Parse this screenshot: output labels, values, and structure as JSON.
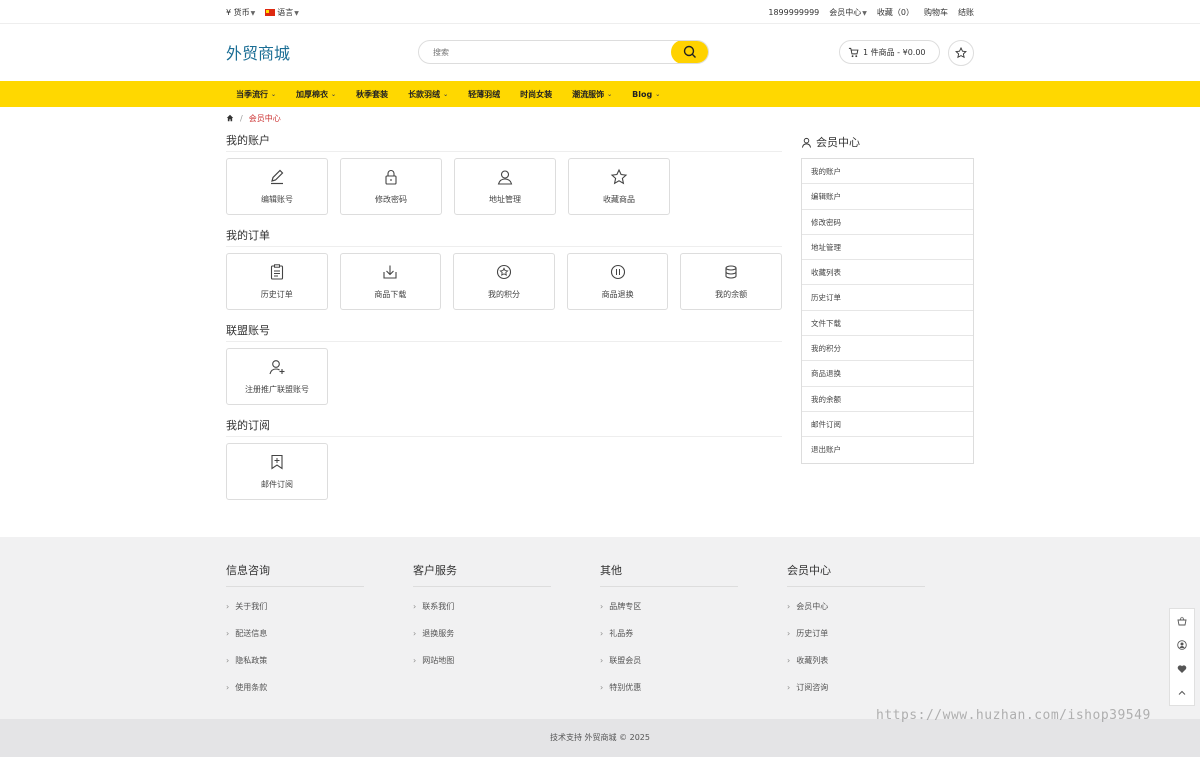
{
  "topbar": {
    "currency_label": "¥ 货币",
    "language_label": "语言",
    "phone": "1899999999",
    "member_center": "会员中心",
    "favorites": "收藏（0）",
    "cart": "购物车",
    "checkout": "结账"
  },
  "header": {
    "logo": "外贸商城",
    "search_placeholder": "搜索",
    "cart_summary": "1 件商品 - ¥0.00"
  },
  "nav": {
    "items": [
      {
        "label": "当季流行",
        "dropdown": true
      },
      {
        "label": "加厚棉衣",
        "dropdown": true
      },
      {
        "label": "秋季套装",
        "dropdown": false
      },
      {
        "label": "长款羽绒",
        "dropdown": true
      },
      {
        "label": "轻薄羽绒",
        "dropdown": false
      },
      {
        "label": "时尚女装",
        "dropdown": false
      },
      {
        "label": "潮流服饰",
        "dropdown": true
      },
      {
        "label": "Blog",
        "dropdown": true
      }
    ]
  },
  "breadcrumb": {
    "current": "会员中心"
  },
  "sections": {
    "account": {
      "title": "我的账户",
      "tiles": [
        "编辑账号",
        "修改密码",
        "地址管理",
        "收藏商品"
      ]
    },
    "orders": {
      "title": "我的订单",
      "tiles": [
        "历史订单",
        "商品下载",
        "我的积分",
        "商品退换",
        "我的余额"
      ]
    },
    "affiliate": {
      "title": "联盟账号",
      "tiles": [
        "注册推广联盟账号"
      ]
    },
    "newsletter": {
      "title": "我的订阅",
      "tiles": [
        "邮件订阅"
      ]
    }
  },
  "sidebar": {
    "title": "会员中心",
    "items": [
      "我的账户",
      "编辑账户",
      "修改密码",
      "地址管理",
      "收藏列表",
      "历史订单",
      "文件下载",
      "我的积分",
      "商品退换",
      "我的余额",
      "邮件订阅",
      "退出账户"
    ]
  },
  "footer": {
    "columns": [
      {
        "title": "信息咨询",
        "links": [
          "关于我们",
          "配送信息",
          "隐私政策",
          "使用条款"
        ]
      },
      {
        "title": "客户服务",
        "links": [
          "联系我们",
          "退换服务",
          "网站地图"
        ]
      },
      {
        "title": "其他",
        "links": [
          "品牌专区",
          "礼品券",
          "联盟会员",
          "特别优惠"
        ]
      },
      {
        "title": "会员中心",
        "links": [
          "会员中心",
          "历史订单",
          "收藏列表",
          "订阅咨询"
        ]
      }
    ],
    "copyright": "技术支持 外贸商城 © 2025"
  },
  "watermark": "https://www.huzhan.com/ishop39549",
  "colors": {
    "accent": "#ffd800",
    "logo": "#1b6e95",
    "breadcrumb_active": "#cc3333"
  }
}
